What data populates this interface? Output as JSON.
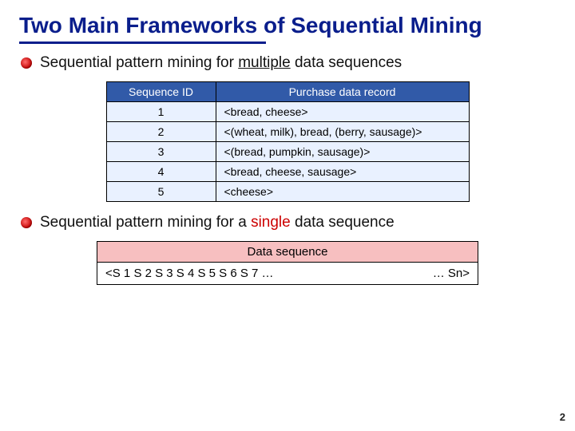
{
  "title": "Two Main Frameworks of Sequential Mining",
  "bullet1": {
    "prefix": "Sequential pattern mining for ",
    "accent": "multiple",
    "suffix": " data sequences"
  },
  "table1": {
    "head_id": "Sequence  ID",
    "head_rec": "Purchase data record",
    "rows": [
      {
        "id": "1",
        "rec": "<bread, cheese>"
      },
      {
        "id": "2",
        "rec": "<(wheat, milk), bread,  (berry, sausage)>"
      },
      {
        "id": "3",
        "rec": "<(bread, pumpkin, sausage)>"
      },
      {
        "id": "4",
        "rec": "<bread, cheese, sausage>"
      },
      {
        "id": "5",
        "rec": "<cheese>"
      }
    ]
  },
  "bullet2": {
    "prefix": "Sequential pattern mining for a ",
    "accent": "single",
    "suffix": " data sequence"
  },
  "table2": {
    "head": "Data sequence",
    "cell_left": "<S 1  S 2  S 3  S 4  S 5  S 6  S 7  …",
    "cell_right": "…  Sn>"
  },
  "page": "2"
}
